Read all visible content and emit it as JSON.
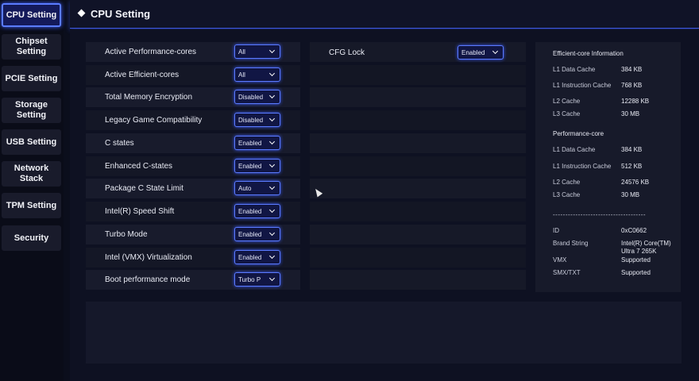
{
  "sidebar": {
    "items": [
      {
        "label": "CPU Setting",
        "active": true
      },
      {
        "label": "Chipset Setting",
        "active": false
      },
      {
        "label": "PCIE Setting",
        "active": false
      },
      {
        "label": "Storage Setting",
        "active": false
      },
      {
        "label": "USB Setting",
        "active": false
      },
      {
        "label": "Network Stack",
        "active": false
      },
      {
        "label": "TPM Setting",
        "active": false
      },
      {
        "label": "Security",
        "active": false
      }
    ]
  },
  "header": {
    "title": "CPU Setting"
  },
  "settings": [
    {
      "label": "Active Performance-cores",
      "value": "All"
    },
    {
      "label": "Active Efficient-cores",
      "value": "All"
    },
    {
      "label": "Total Memory Encryption",
      "value": "Disabled"
    },
    {
      "label": "Legacy Game Compatibility",
      "value": "Disabled"
    },
    {
      "label": "C states",
      "value": "Enabled"
    },
    {
      "label": "Enhanced C-states",
      "value": "Enabled"
    },
    {
      "label": "Package C State Limit",
      "value": "Auto"
    },
    {
      "label": "Intel(R) Speed Shift",
      "value": "Enabled"
    },
    {
      "label": "Turbo Mode",
      "value": "Enabled"
    },
    {
      "label": "Intel (VMX) Virtualization",
      "value": "Enabled"
    },
    {
      "label": "Boot performance mode",
      "value": "Turbo P"
    }
  ],
  "settings_col2": [
    {
      "label": "CFG Lock",
      "value": "Enabled"
    }
  ],
  "info": {
    "efficient_heading": "Efficient-core Information",
    "efficient": [
      {
        "key": "L1 Data Cache",
        "value": "384 KB"
      },
      {
        "key": "L1 Instruction Cache",
        "value": "768 KB"
      },
      {
        "key": "L2 Cache",
        "value": "12288 KB"
      },
      {
        "key": "L3 Cache",
        "value": "30 MB"
      }
    ],
    "performance_heading": "Performance-core",
    "performance": [
      {
        "key": "L1 Data Cache",
        "value": "384 KB"
      },
      {
        "key": "L1 Instruction Cache",
        "value": "512 KB"
      },
      {
        "key": "L2 Cache",
        "value": "24576 KB"
      },
      {
        "key": "L3 Cache",
        "value": "30 MB"
      }
    ],
    "divider": "-------------------------------------",
    "general": [
      {
        "key": "ID",
        "value": "0xC0662"
      },
      {
        "key": "Brand String",
        "value": "Intel(R) Core(TM) Ultra 7 265K"
      },
      {
        "key": "VMX",
        "value": "Supported"
      },
      {
        "key": "SMX/TXT",
        "value": "Supported"
      }
    ]
  },
  "colors": {
    "accent": "#5a7cff",
    "background": "#0b0e1c",
    "panel": "#181b2c"
  }
}
